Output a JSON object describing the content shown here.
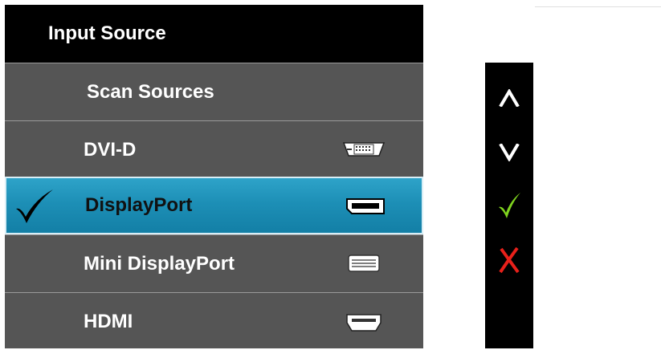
{
  "menu": {
    "title": "Input Source",
    "items": [
      {
        "label": "Scan Sources",
        "icon": "",
        "selected": false
      },
      {
        "label": "DVI-D",
        "icon": "dvi-port-icon",
        "selected": false
      },
      {
        "label": "DisplayPort",
        "icon": "displayport-port-icon",
        "selected": true
      },
      {
        "label": "Mini DisplayPort",
        "icon": "mini-displayport-port-icon",
        "selected": false
      },
      {
        "label": "HDMI",
        "icon": "hdmi-port-icon",
        "selected": false
      }
    ],
    "selection_icon": "checkmark-icon"
  },
  "buttons": [
    {
      "icon": "up-arrow-icon",
      "color": "#ffffff"
    },
    {
      "icon": "down-arrow-icon",
      "color": "#ffffff"
    },
    {
      "icon": "confirm-check-icon",
      "color": "#7fd31e"
    },
    {
      "icon": "exit-x-icon",
      "color": "#e8201a"
    }
  ],
  "colors": {
    "menu_bg": "#555555",
    "title_bg": "#000000",
    "selected_bg": "#1d8fb6",
    "button_panel_bg": "#000000"
  }
}
